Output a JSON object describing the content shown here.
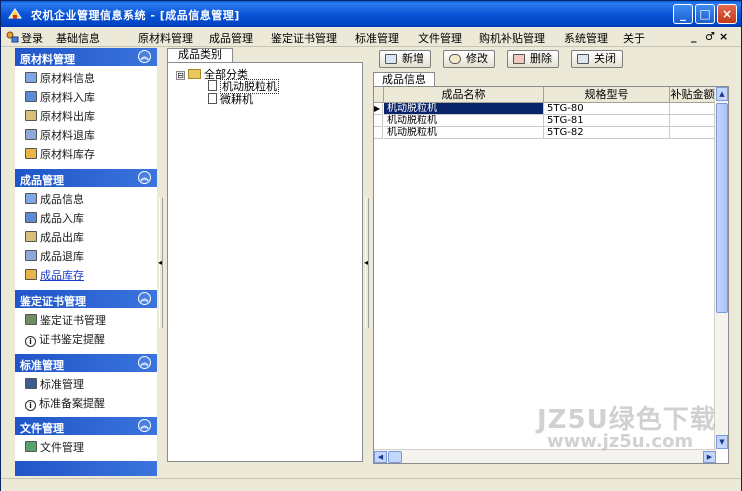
{
  "window": {
    "title": "农机企业管理信息系统 - [成品信息管理]",
    "minimize": "_",
    "maximize": "□",
    "close": "×",
    "mdi_min": "_",
    "mdi_restore": "♂",
    "mdi_close": "×"
  },
  "menu": {
    "items": [
      "登录",
      "基础信息",
      "原材料管理",
      "成品管理",
      "鉴定证书管理",
      "标准管理",
      "文件管理",
      "购机补贴管理",
      "系统管理",
      "关于"
    ]
  },
  "leftnav": {
    "groups": [
      {
        "title": "原材料管理",
        "items": [
          "原材料信息",
          "原材料入库",
          "原材料出库",
          "原材料退库",
          "原材料库存"
        ]
      },
      {
        "title": "成品管理",
        "items": [
          "成品信息",
          "成品入库",
          "成品出库",
          "成品退库",
          "成品库存"
        ]
      },
      {
        "title": "鉴定证书管理",
        "items": [
          "鉴定证书管理",
          "证书鉴定提醒"
        ]
      },
      {
        "title": "标准管理",
        "items": [
          "标准管理",
          "标准备案提醒"
        ]
      },
      {
        "title": "文件管理",
        "items": [
          "文件管理"
        ]
      }
    ],
    "collapse_glyph": "︽"
  },
  "tree": {
    "tab": "成品类别",
    "root": "全部分类",
    "children": [
      "机动脱粒机",
      "微耕机"
    ],
    "expander": "⊟"
  },
  "toolbar": {
    "add": "新增",
    "edit": "修改",
    "delete": "删除",
    "close": "关闭"
  },
  "grid": {
    "tab": "成品信息",
    "columns": [
      "成品名称",
      "规格型号",
      "补贴金额"
    ],
    "rows": [
      [
        "机动脱粒机",
        "5TG-80"
      ],
      [
        "机动脱粒机",
        "5TG-81"
      ],
      [
        "机动脱粒机",
        "5TG-82"
      ]
    ],
    "selected_row": 0
  },
  "watermark": {
    "line1": "JZ5U绿色下载",
    "line2": "www.jz5u.com"
  },
  "colors": {
    "title_bar": "#0b55d6",
    "nav_header": "#1f55c9",
    "selection": "#0a246a"
  }
}
